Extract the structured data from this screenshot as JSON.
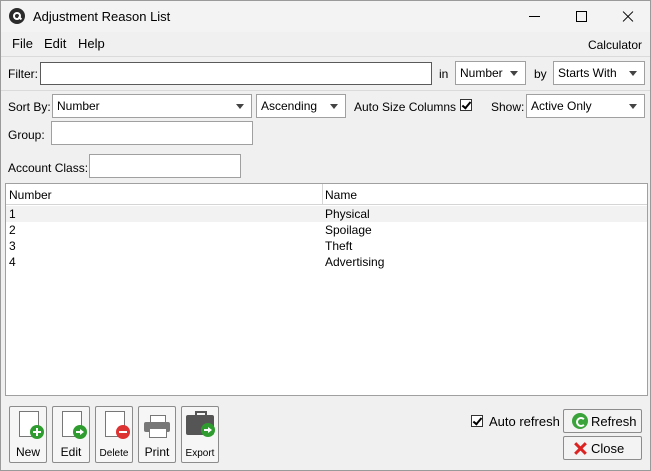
{
  "window": {
    "title": "Adjustment Reason List"
  },
  "menu": {
    "file": "File",
    "edit": "Edit",
    "help": "Help",
    "calculator": "Calculator"
  },
  "filter": {
    "label": "Filter:",
    "value": "",
    "in_label": "in",
    "in_value": "Number",
    "by_label": "by",
    "by_value": "Starts With"
  },
  "sort": {
    "label": "Sort By:",
    "field": "Number",
    "order": "Ascending",
    "auto_size_label": "Auto Size Columns",
    "auto_size_checked": true,
    "show_label": "Show:",
    "show_value": "Active Only"
  },
  "group": {
    "label": "Group:",
    "value": ""
  },
  "account_class": {
    "label": "Account Class:",
    "value": ""
  },
  "table": {
    "columns": [
      "Number",
      "Name"
    ],
    "rows": [
      {
        "number": "1",
        "name": "Physical"
      },
      {
        "number": "2",
        "name": "Spoilage"
      },
      {
        "number": "3",
        "name": "Theft"
      },
      {
        "number": "4",
        "name": "Advertising"
      }
    ]
  },
  "toolbar": {
    "new": "New",
    "edit": "Edit",
    "delete": "Delete",
    "print": "Print",
    "export": "Export"
  },
  "footer": {
    "auto_refresh_label": "Auto refresh",
    "auto_refresh_checked": true,
    "refresh": "Refresh",
    "close": "Close"
  },
  "icons": {
    "app": "app-logo-icon",
    "new": "new-document-icon",
    "edit": "edit-document-icon",
    "delete": "delete-document-icon",
    "print": "printer-icon",
    "export": "export-briefcase-icon",
    "refresh": "refresh-icon",
    "close": "close-icon"
  }
}
